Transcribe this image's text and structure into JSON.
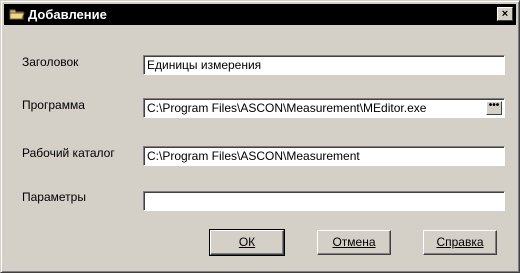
{
  "window": {
    "title": "Добавление",
    "close_glyph": "×"
  },
  "form": {
    "title_label": "Заголовок",
    "title_value": "Единицы измерения",
    "program_label": "Программа",
    "program_value": "C:\\Program Files\\ASCON\\Measurement\\MEditor.exe",
    "browse_label": "•••",
    "workdir_label": "Рабочий каталог",
    "workdir_value": "C:\\Program Files\\ASCON\\Measurement",
    "params_label": "Параметры",
    "params_value": ""
  },
  "buttons": {
    "ok": "ОК",
    "cancel": "Отмена",
    "help": "Справка"
  },
  "icons": {
    "title_icon": "folder-icon",
    "close_icon": "close-icon",
    "browse_icon": "ellipsis-icon"
  },
  "colors": {
    "titlebar": "#000000",
    "dialog_bg": "#d4d0c8"
  }
}
